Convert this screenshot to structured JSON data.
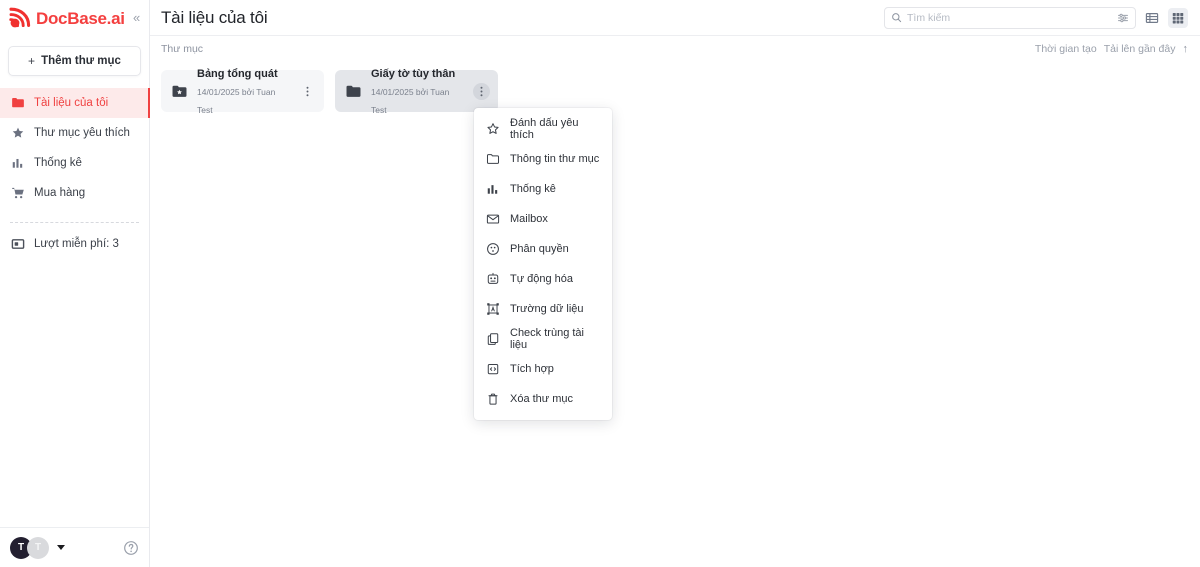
{
  "brand": {
    "name": "DocBase.ai",
    "logo_icon": "docbase-signal-logo",
    "collapse_icon": "chevron-double-left-icon",
    "accent_color": "#f43f3f"
  },
  "sidebar": {
    "add_folder": {
      "label": "Thêm thư mục",
      "icon": "plus-icon"
    },
    "items": [
      {
        "label": "Tài liệu của tôi",
        "icon": "folder-icon",
        "active": true
      },
      {
        "label": "Thư mục yêu thích",
        "icon": "star-icon",
        "active": false
      },
      {
        "label": "Thống kê",
        "icon": "bar-chart-icon",
        "active": false
      },
      {
        "label": "Mua hàng",
        "icon": "shopping-cart-icon",
        "active": false
      }
    ],
    "free_quota": {
      "label": "Lượt miễn phí: 3",
      "icon": "credit-card-icon"
    },
    "footer": {
      "avatar_primary": "T",
      "avatar_secondary": "T",
      "caret_icon": "caret-down-icon",
      "help_icon": "help-circle-icon"
    }
  },
  "header": {
    "title": "Tài liệu của tôi",
    "search": {
      "placeholder": "Tìm kiếm",
      "value": "",
      "icon": "search-icon",
      "filter_icon": "filter-sliders-icon"
    },
    "views": [
      {
        "name": "list-view",
        "icon": "list-view-icon",
        "active": false
      },
      {
        "name": "grid-view",
        "icon": "grid-view-icon",
        "active": true
      }
    ]
  },
  "subbar": {
    "breadcrumb": "Thư mục",
    "sort_options": [
      {
        "label": "Thời gian tạo",
        "active": false
      },
      {
        "label": "Tải lên gần đây",
        "active": true
      }
    ],
    "sort_direction_icon": "arrow-up-icon"
  },
  "folders": [
    {
      "title": "Bảng tổng quát",
      "subtitle": "14/01/2025 bởi Tuan Test",
      "icon": "folder-star-icon",
      "selected": false,
      "menu_icon": "kebab-menu-icon"
    },
    {
      "title": "Giấy tờ tùy thân",
      "subtitle": "14/01/2025 bởi Tuan Test",
      "icon": "folder-icon",
      "selected": true,
      "menu_icon": "kebab-menu-icon"
    }
  ],
  "context_menu": {
    "items": [
      {
        "label": "Đánh dấu yêu thích",
        "icon": "star-outline-icon"
      },
      {
        "label": "Thông tin thư mục",
        "icon": "folder-outline-icon"
      },
      {
        "label": "Thống kê",
        "icon": "bar-chart-icon"
      },
      {
        "label": "Mailbox",
        "icon": "envelope-icon"
      },
      {
        "label": "Phân quyền",
        "icon": "permissions-circle-icon"
      },
      {
        "label": "Tự động hóa",
        "icon": "robot-icon"
      },
      {
        "label": "Trường dữ liệu",
        "icon": "data-field-frame-icon"
      },
      {
        "label": "Check trùng tài liệu",
        "icon": "duplicate-copy-icon"
      },
      {
        "label": "Tích hợp",
        "icon": "integration-code-icon"
      },
      {
        "label": "Xóa thư mục",
        "icon": "trash-icon"
      }
    ]
  }
}
